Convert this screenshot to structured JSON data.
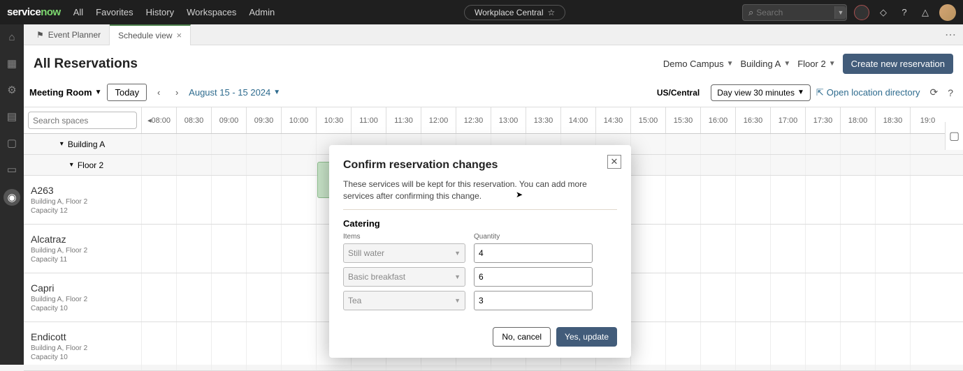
{
  "topnav": {
    "logo_prefix": "service",
    "logo_suffix": "now",
    "items": [
      "All",
      "Favorites",
      "History",
      "Workspaces",
      "Admin"
    ],
    "workspace": "Workplace Central",
    "search_placeholder": "Search"
  },
  "tabs": [
    {
      "label": "Event Planner",
      "active": false,
      "closable": false
    },
    {
      "label": "Schedule view",
      "active": true,
      "closable": true
    }
  ],
  "page_title": "All Reservations",
  "breadcrumbs": [
    "Demo Campus",
    "Building A",
    "Floor 2"
  ],
  "create_button": "Create new reservation",
  "toolbar": {
    "room_filter": "Meeting Room",
    "today": "Today",
    "date_range": "August 15 - 15 2024",
    "timezone": "US/Central",
    "dayview": "Day view 30 minutes",
    "open_location": "Open location directory"
  },
  "search_spaces_placeholder": "Search spaces",
  "time_slots": [
    "08:00",
    "08:30",
    "09:00",
    "09:30",
    "10:00",
    "10:30",
    "11:00",
    "11:30",
    "12:00",
    "12:30",
    "13:00",
    "13:30",
    "14:00",
    "14:30",
    "15:00",
    "15:30",
    "16:00",
    "16:30",
    "17:00",
    "17:30",
    "18:00",
    "18:30",
    "19:0"
  ],
  "groups": [
    {
      "label": "Building A",
      "level": 0
    },
    {
      "label": "Floor 2",
      "level": 1
    }
  ],
  "rooms": [
    {
      "name": "A263",
      "location": "Building A, Floor 2",
      "capacity": "Capacity 12"
    },
    {
      "name": "Alcatraz",
      "location": "Building A, Floor 2",
      "capacity": "Capacity 11"
    },
    {
      "name": "Capri",
      "location": "Building A, Floor 2",
      "capacity": "Capacity 10"
    },
    {
      "name": "Endicott",
      "location": "Building A, Floor 2",
      "capacity": "Capacity 10"
    }
  ],
  "modal": {
    "title": "Confirm reservation changes",
    "description": "These services will be kept for this reservation. You can add more services after confirming this change.",
    "section_title": "Catering",
    "items_label": "Items",
    "qty_label": "Quantity",
    "rows": [
      {
        "item": "Still water",
        "qty": "4"
      },
      {
        "item": "Basic breakfast",
        "qty": "6"
      },
      {
        "item": "Tea",
        "qty": "3"
      }
    ],
    "cancel": "No, cancel",
    "confirm": "Yes, update"
  }
}
